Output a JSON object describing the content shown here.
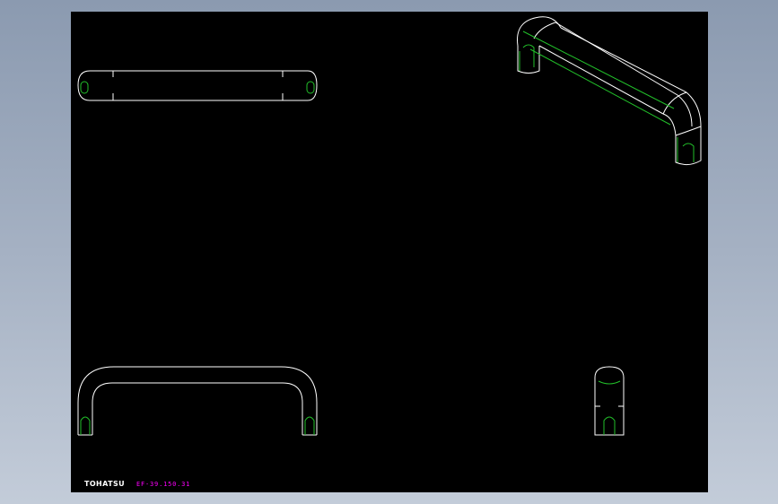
{
  "drawing": {
    "brand": "TOHATSU",
    "part_code": "EF-39.150.31"
  },
  "colors": {
    "background_top": "#8b9ab0",
    "background_bottom": "#c3ccd9",
    "viewport": "#000000",
    "outline": "#ffffff",
    "hidden_edges": "#22c02a",
    "brand": "#ffffff",
    "part_code": "#ff00ff"
  },
  "views": [
    {
      "name": "top-view"
    },
    {
      "name": "isometric-view"
    },
    {
      "name": "front-view"
    },
    {
      "name": "side-view"
    }
  ]
}
